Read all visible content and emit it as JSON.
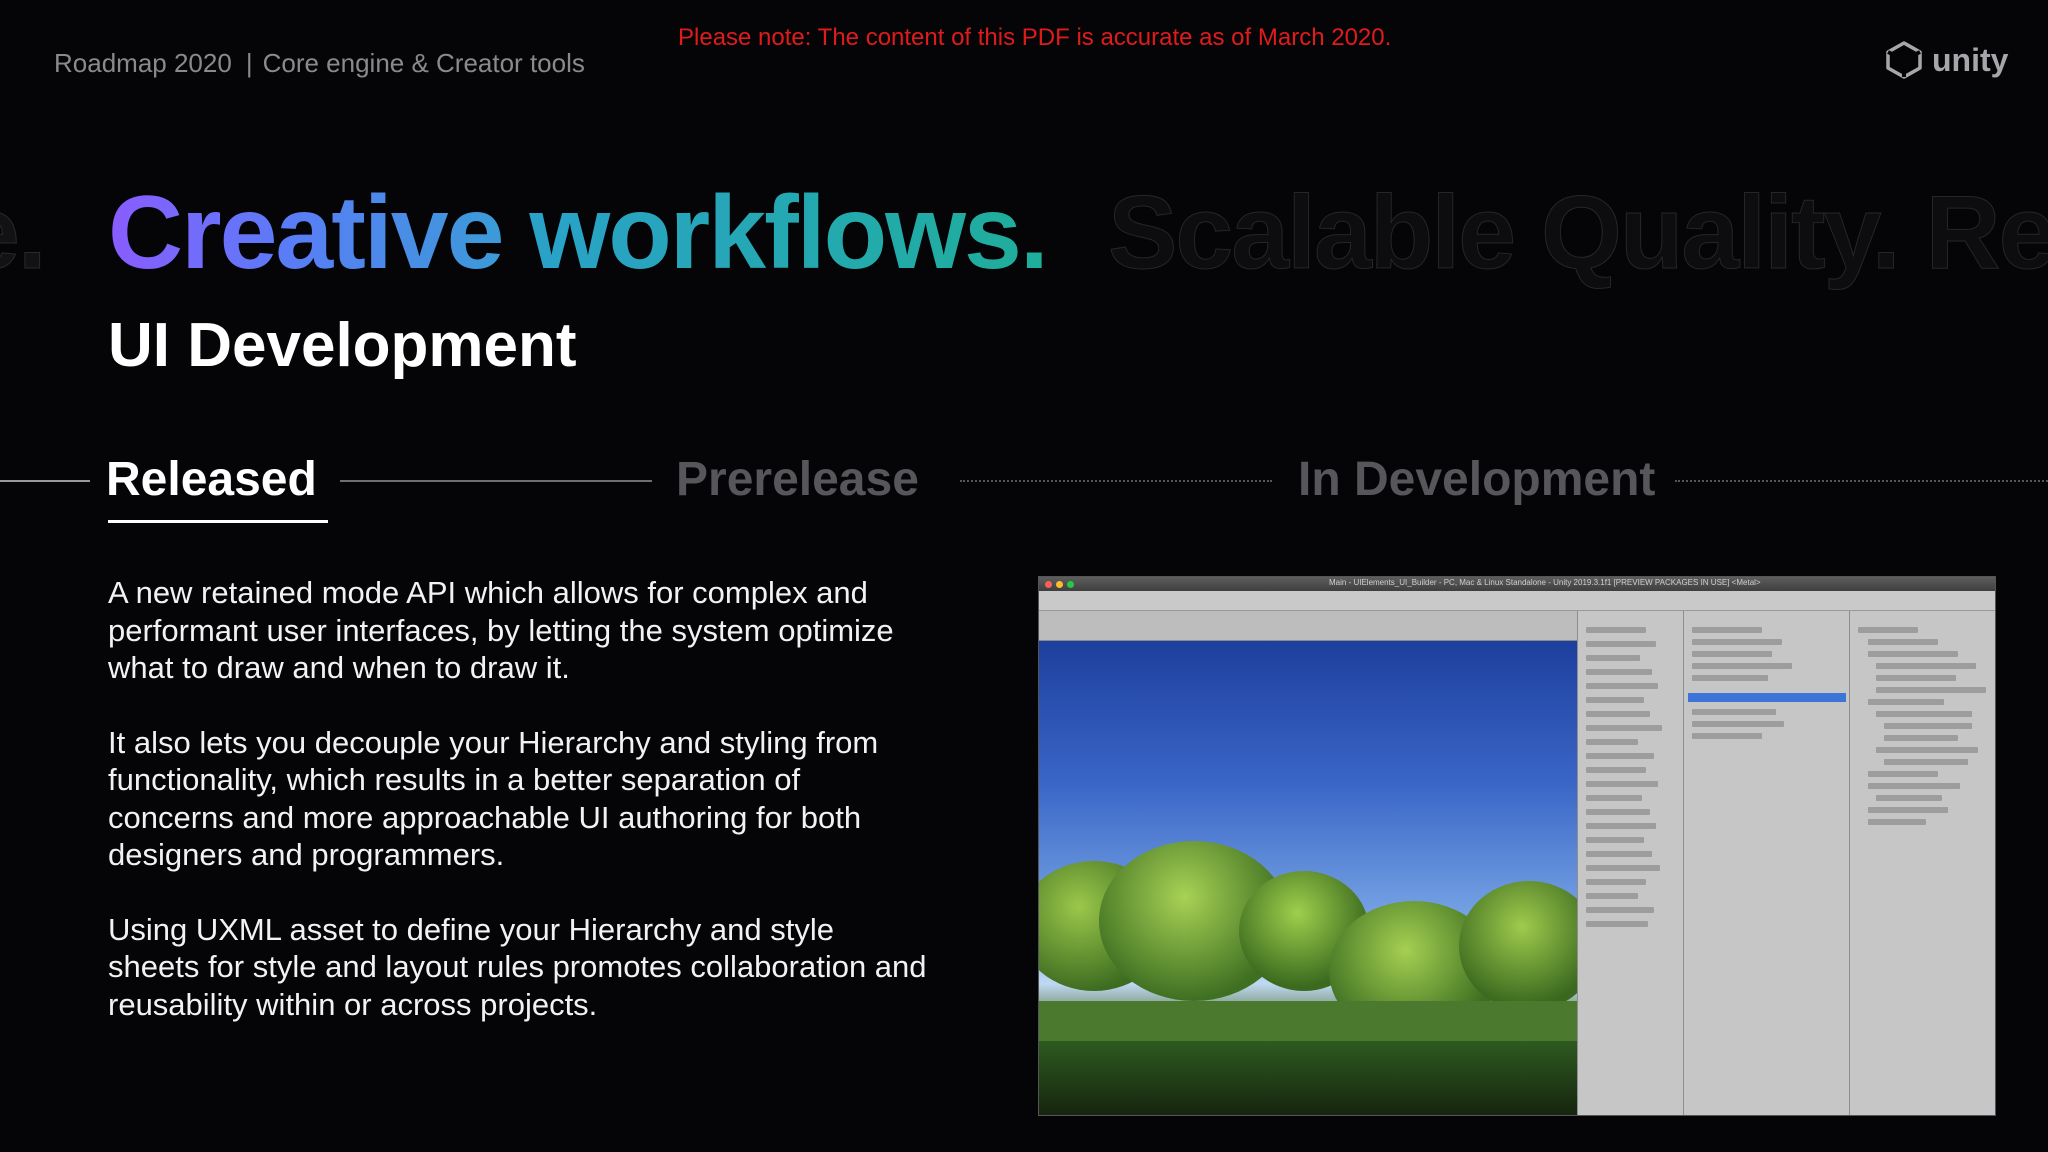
{
  "header": {
    "deck": "Roadmap 2020",
    "section": "Core engine & Creator tools",
    "notice": "Please note: The content of this PDF is accurate as of March 2020.",
    "logo_text": "unity"
  },
  "hero": {
    "ghost_left": "e.",
    "title_word1": "Creative",
    "title_word2": "workflows.",
    "ghost_right": "Scalable Quality.  Re"
  },
  "subtitle": "UI Development",
  "stages": {
    "released": "Released",
    "prerelease": "Prerelease",
    "in_development": "In Development",
    "active": "Released"
  },
  "body": {
    "p1": "A new retained mode API which allows for complex and performant user interfaces, by letting the system optimize what to draw and when to draw it.",
    "p2": "It also lets you decouple your Hierarchy and styling from functionality, which results in a better separation of concerns and more approachable UI authoring for both designers and programmers.",
    "p3": "Using UXML asset to define your Hierarchy and style sheets for style and layout rules promotes collaboration and reusability within or across projects."
  },
  "screenshot": {
    "window_title": "Main - UIElements_UI_Builder - PC, Mac & Linux Standalone - Unity 2019.3.1f1 [PREVIEW PACKAGES IN USE] <Metal>"
  },
  "colors": {
    "background": "#050507",
    "notice": "#e01b1b",
    "gradient_start": "#8a5cff",
    "gradient_end": "#1fae9a",
    "inactive_stage": "#56565b"
  }
}
